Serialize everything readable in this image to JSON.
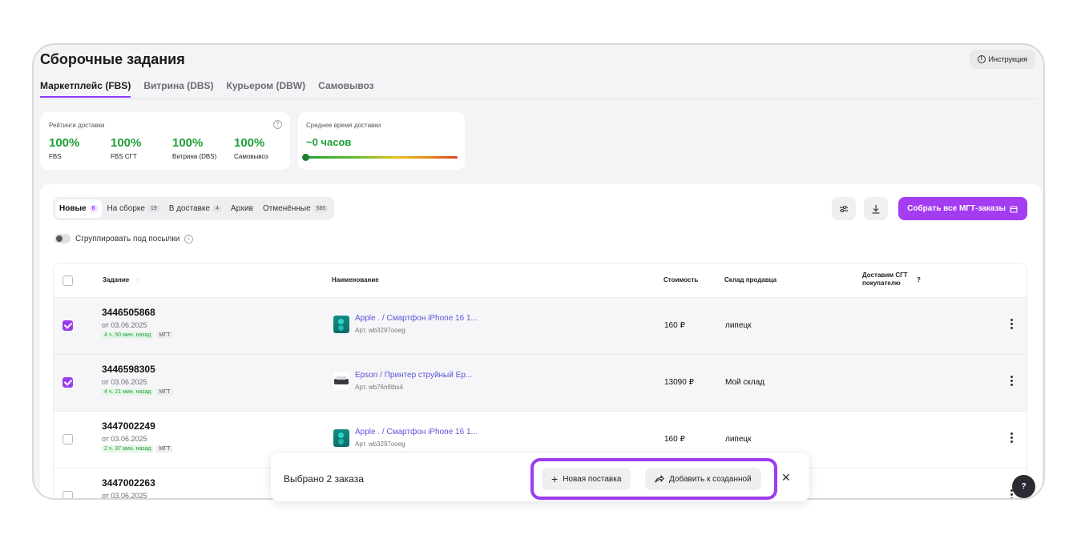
{
  "page": {
    "title": "Сборочные задания",
    "help_label": "Инструкция"
  },
  "main_tabs": [
    {
      "label": "Маркетплейс (FBS)",
      "active": true
    },
    {
      "label": "Витрина (DBS)",
      "active": false
    },
    {
      "label": "Курьером (DBW)",
      "active": false
    },
    {
      "label": "Самовывоз",
      "active": false
    }
  ],
  "ratings": {
    "caption": "Рейтинги доставки",
    "stats": [
      {
        "value": "100%",
        "label": "FBS"
      },
      {
        "value": "100%",
        "label": "FBS СГТ"
      },
      {
        "value": "100%",
        "label": "Витрина (DBS)"
      },
      {
        "value": "100%",
        "label": "Самовывоз"
      }
    ]
  },
  "delivery_time": {
    "caption": "Среднее время доставки",
    "value": "~0 часов"
  },
  "status_tabs": [
    {
      "label": "Новые",
      "count": "6",
      "active": true
    },
    {
      "label": "На сборке",
      "count": "19",
      "active": false
    },
    {
      "label": "В доставке",
      "count": "4",
      "active": false
    },
    {
      "label": "Архив",
      "count": "",
      "active": false
    },
    {
      "label": "Отменённые",
      "count": "585",
      "active": false
    }
  ],
  "toolbar": {
    "primary_label": "Собрать все МГТ-заказы"
  },
  "group_toggle": {
    "label": "Сгруппировать под посылки"
  },
  "table": {
    "headers": {
      "task": "Задание",
      "name": "Наименование",
      "price": "Стоимость",
      "warehouse": "Склад продавца",
      "sgt_line1": "Доставим СГТ",
      "sgt_line2": "покупателю"
    },
    "rows": [
      {
        "id": "3446505868",
        "date": "от 03.06.2025",
        "age": "4 ч. 50 мин. назад",
        "tag": "МГТ",
        "name": "Apple . / Смартфон iPhone 16 1...",
        "art": "Арт. wb3297ooeg",
        "price": "160 ₽",
        "warehouse": "липецк",
        "checked": true,
        "thumb": "phone"
      },
      {
        "id": "3446598305",
        "date": "от 03.06.2025",
        "age": "4 ч. 21 мин. назад",
        "tag": "МГТ",
        "name": "Epson / Принтер струйный Ep...",
        "art": "Арт. wb76n6tbs4",
        "price": "13090 ₽",
        "warehouse": "Мой склад",
        "checked": true,
        "thumb": "printer"
      },
      {
        "id": "3447002249",
        "date": "от 03.06.2025",
        "age": "2 ч. 37 мин. назад",
        "tag": "МГТ",
        "name": "Apple . / Смартфон iPhone 16 1...",
        "art": "Арт. wb3297ooeg",
        "price": "160 ₽",
        "warehouse": "липецк",
        "checked": false,
        "thumb": "phone"
      },
      {
        "id": "3447002263",
        "date": "от 03.06.2025",
        "checked": false
      }
    ]
  },
  "action_bar": {
    "selected_text": "Выбрано 2 заказа",
    "new_supply_label": "Новая поставка",
    "add_existing_label": "Добавить к созданной"
  },
  "fab": {
    "label": "?"
  },
  "colors": {
    "accent": "#a43cf2",
    "success": "#1e9f36",
    "link": "#5a55d6"
  },
  "icons": [
    "info-icon",
    "filter-settings-icon",
    "download-icon",
    "box-icon",
    "sort-arrow-icon",
    "plus-icon",
    "share-arrow-icon",
    "close-icon",
    "more-vertical-icon"
  ]
}
